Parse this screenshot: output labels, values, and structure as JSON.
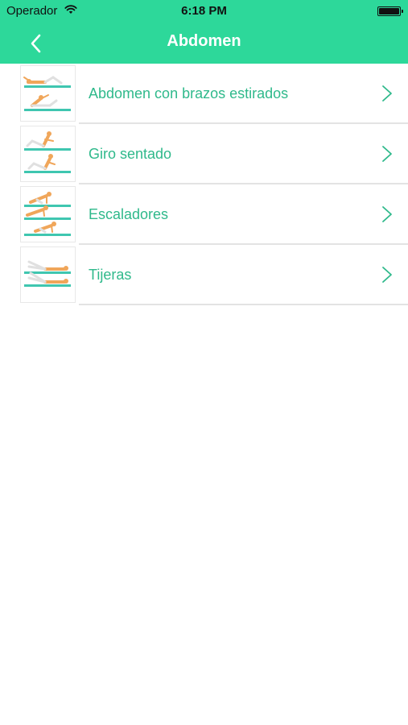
{
  "status_bar": {
    "carrier": "Operador",
    "time": "6:18 PM",
    "battery_level": 1.0
  },
  "nav": {
    "title": "Abdomen",
    "back_icon": "chevron-left-icon"
  },
  "colors": {
    "accent": "#2dd89a",
    "label_text": "#2fb98b",
    "mat": "#3fc6b0",
    "skin": "#f0a65a"
  },
  "exercises": [
    {
      "label": "Abdomen con brazos estirados",
      "thumbnail_icon": "exercise-thumbnail-icon"
    },
    {
      "label": "Giro sentado",
      "thumbnail_icon": "exercise-thumbnail-icon"
    },
    {
      "label": "Escaladores",
      "thumbnail_icon": "exercise-thumbnail-icon"
    },
    {
      "label": "Tijeras",
      "thumbnail_icon": "exercise-thumbnail-icon"
    }
  ]
}
